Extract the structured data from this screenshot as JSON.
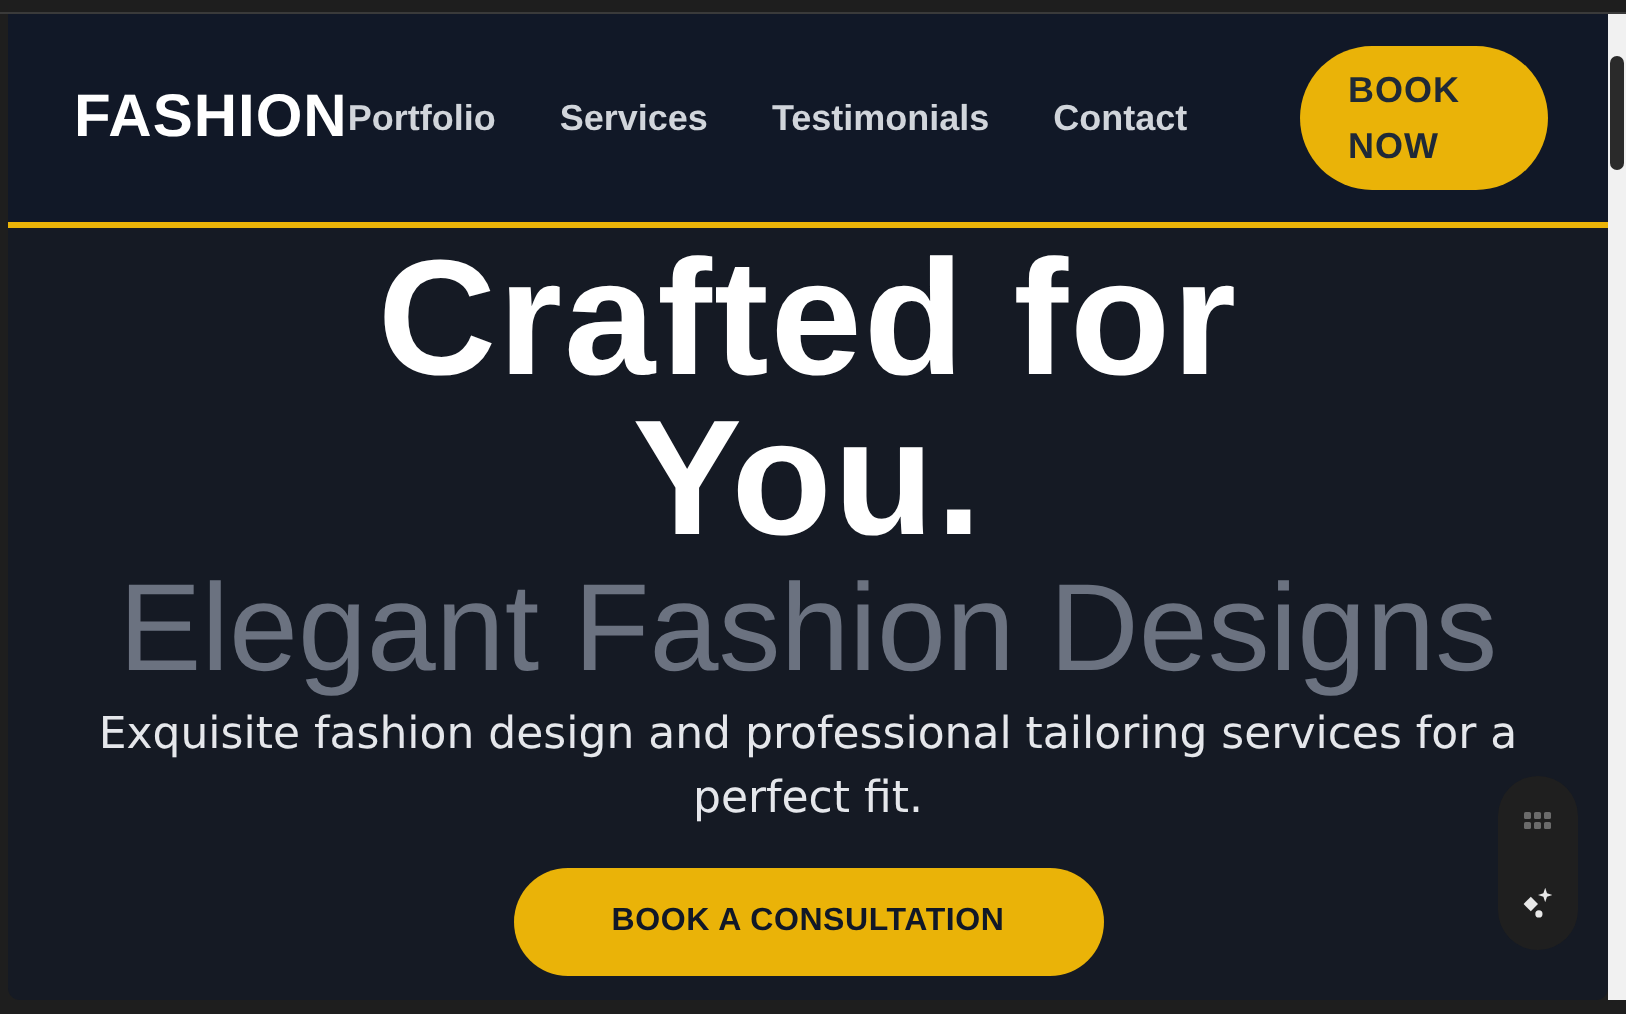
{
  "header": {
    "logo": "FASHION",
    "nav": [
      {
        "label": "Portfolio"
      },
      {
        "label": "Services"
      },
      {
        "label": "Testimonials"
      },
      {
        "label": "Contact"
      }
    ],
    "cta": "BOOK NOW"
  },
  "hero": {
    "headline": "Crafted for You.",
    "subtitle": "Elegant Fashion Designs",
    "description": "Exquisite fashion design and professional tailoring services for a perfect fit.",
    "button": "BOOK A CONSULTATION"
  }
}
